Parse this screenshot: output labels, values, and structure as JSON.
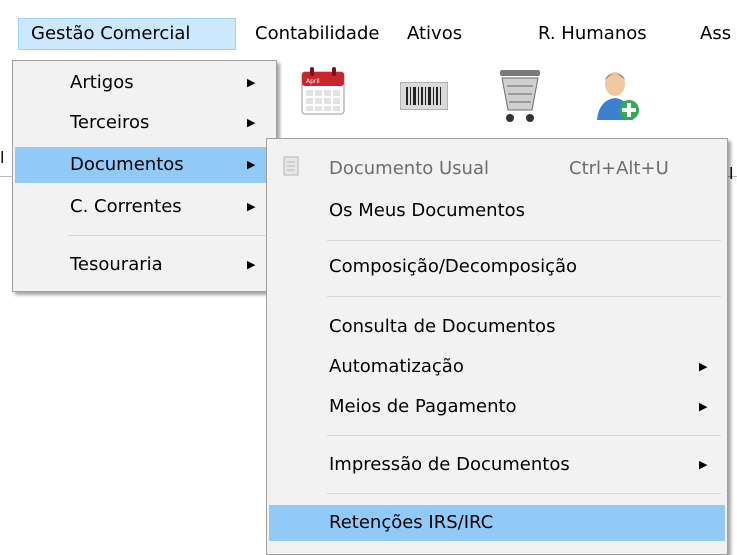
{
  "menubar": {
    "items": [
      {
        "label": "Gestão Comercial"
      },
      {
        "label": "Contabilidade"
      },
      {
        "label": "Ativos"
      },
      {
        "label": "R. Humanos"
      },
      {
        "label": "Ass"
      }
    ]
  },
  "toolbar": {
    "icons": [
      "calendar-icon",
      "barcode-icon",
      "shopping-cart-icon",
      "add-user-icon"
    ],
    "calendar_text": "April"
  },
  "menu1": {
    "items": [
      {
        "label": "Artigos"
      },
      {
        "label": "Terceiros"
      },
      {
        "label": "Documentos"
      },
      {
        "label": "C. Correntes"
      },
      {
        "label": "Tesouraria"
      }
    ]
  },
  "menu2": {
    "items": [
      {
        "label": "Documento Usual",
        "shortcut": "Ctrl+Alt+U"
      },
      {
        "label": "Os Meus Documentos"
      },
      {
        "label": "Composição/Decomposição"
      },
      {
        "label": "Consulta de Documentos"
      },
      {
        "label": "Automatização"
      },
      {
        "label": "Meios de Pagamento"
      },
      {
        "label": "Impressão de Documentos"
      },
      {
        "label": "Retenções IRS/IRC"
      }
    ]
  }
}
